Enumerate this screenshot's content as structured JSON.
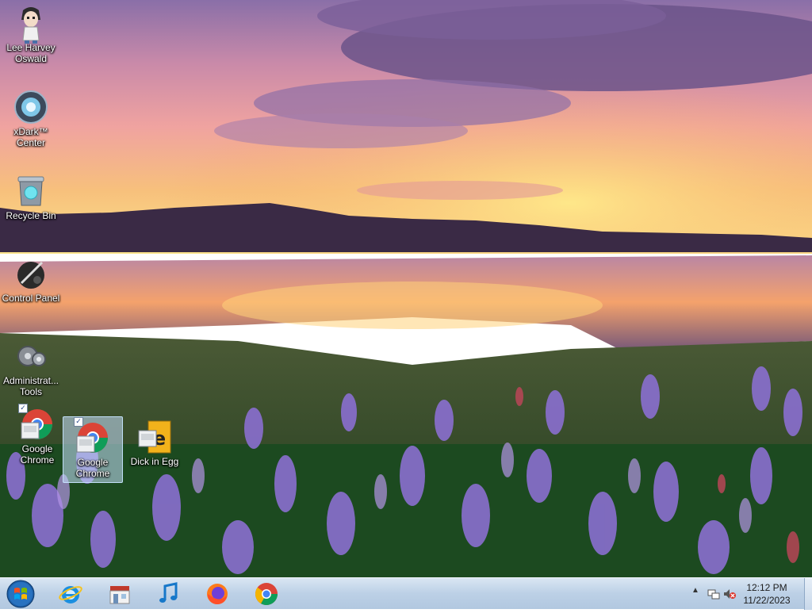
{
  "desktop": {
    "icons": [
      {
        "label": "Lee Harvey Oswald",
        "icon": "anime-character-icon"
      },
      {
        "label": "xDark™ Center",
        "icon": "xdark-center-icon"
      },
      {
        "label": "Recycle Bin",
        "icon": "recycle-bin-icon"
      },
      {
        "label": "Control Panel",
        "icon": "control-panel-icon"
      },
      {
        "label": "Administrat... Tools",
        "icon": "administrative-tools-icon"
      },
      {
        "label": "Google Chrome",
        "icon": "chrome-shortcut-icon"
      },
      {
        "label": "Google Chrome",
        "icon": "chrome-shortcut-icon"
      },
      {
        "label": "Dick in Egg",
        "icon": "dick-in-egg-icon"
      }
    ]
  },
  "taskbar": {
    "pinned": [
      {
        "name": "Internet Explorer",
        "icon": "internet-explorer-icon"
      },
      {
        "name": "Store",
        "icon": "store-icon"
      },
      {
        "name": "Music",
        "icon": "music-icon"
      },
      {
        "name": "Firefox",
        "icon": "firefox-icon"
      },
      {
        "name": "Chrome",
        "icon": "chrome-icon"
      }
    ],
    "clock": {
      "time": "12:12 PM",
      "date": "11/22/2023"
    },
    "tray": [
      "show-hidden-icons-chevron",
      "network-icon",
      "volume-muted-icon"
    ]
  }
}
